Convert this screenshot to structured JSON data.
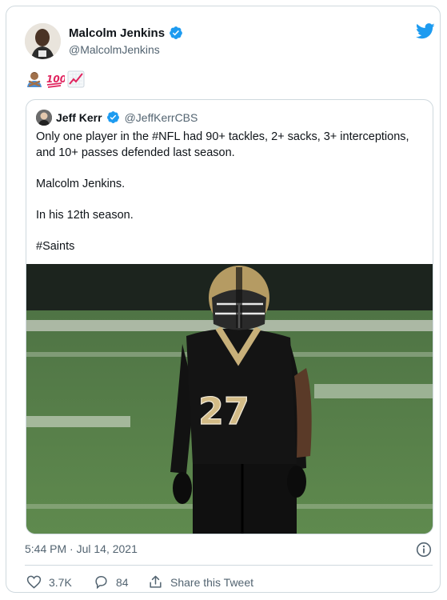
{
  "author": {
    "name": "Malcolm Jenkins",
    "handle": "@MalcolmJenkins"
  },
  "tweet": {
    "emojis": [
      "man-gesturing-no",
      "hundred-points",
      "chart-increasing"
    ]
  },
  "quoted": {
    "name": "Jeff Kerr",
    "handle": "@JeffKerrCBS",
    "paragraphs": [
      "Only one player in the #NFL had 90+ tackles, 2+ sacks, 3+ interceptions, and 10+ passes defended last season.",
      "Malcolm Jenkins.",
      "In his 12th season.",
      "#Saints"
    ],
    "photo_jersey_number": "27"
  },
  "meta": {
    "timestamp": "5:44 PM · Jul 14, 2021"
  },
  "actions": {
    "likes": "3.7K",
    "replies": "84",
    "share_label": "Share this Tweet"
  },
  "colors": {
    "twitter_blue": "#1d9bf0",
    "text_secondary": "#536471",
    "border": "#cfd9de"
  }
}
